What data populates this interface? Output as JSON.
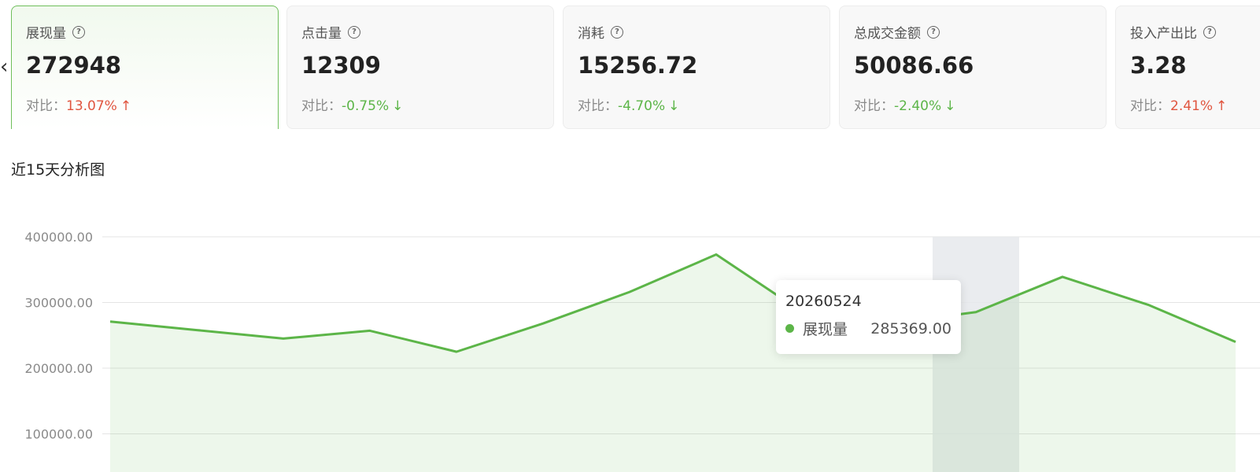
{
  "colors": {
    "accent": "#5cb548",
    "up": "#e0553f",
    "down": "#5cb548"
  },
  "cards": [
    {
      "title": "展现量",
      "value": "272948",
      "compare_label": "对比：",
      "compare_value": "13.07%",
      "arrow": "↑",
      "trend": "up",
      "active": true
    },
    {
      "title": "点击量",
      "value": "12309",
      "compare_label": "对比：",
      "compare_value": "-0.75%",
      "arrow": "↓",
      "trend": "down",
      "active": false
    },
    {
      "title": "消耗",
      "value": "15256.72",
      "compare_label": "对比：",
      "compare_value": "-4.70%",
      "arrow": "↓",
      "trend": "down",
      "active": false
    },
    {
      "title": "总成交金额",
      "value": "50086.66",
      "compare_label": "对比：",
      "compare_value": "-2.40%",
      "arrow": "↓",
      "trend": "down",
      "active": false
    },
    {
      "title": "投入产出比",
      "value": "3.28",
      "compare_label": "对比：",
      "compare_value": "2.41%",
      "arrow": "↑",
      "trend": "up",
      "active": false
    }
  ],
  "icons": {
    "help": "question-circle-icon",
    "prev": "chevron-left-icon"
  },
  "section_title": "近15天分析图",
  "tooltip": {
    "date": "20260524",
    "series": "展现量",
    "value": "285369.00"
  },
  "chart_data": {
    "type": "area",
    "series": [
      {
        "name": "展现量",
        "values": [
          271000,
          258000,
          245000,
          257000,
          225000,
          268000,
          316000,
          373000,
          285000,
          268000,
          285369,
          339000,
          296000,
          240000
        ]
      }
    ],
    "highlight_index": 10,
    "ylim": [
      0,
      400000
    ],
    "yticks": [
      "400000.00",
      "300000.00",
      "200000.00",
      "100000.00"
    ],
    "grid": true
  }
}
